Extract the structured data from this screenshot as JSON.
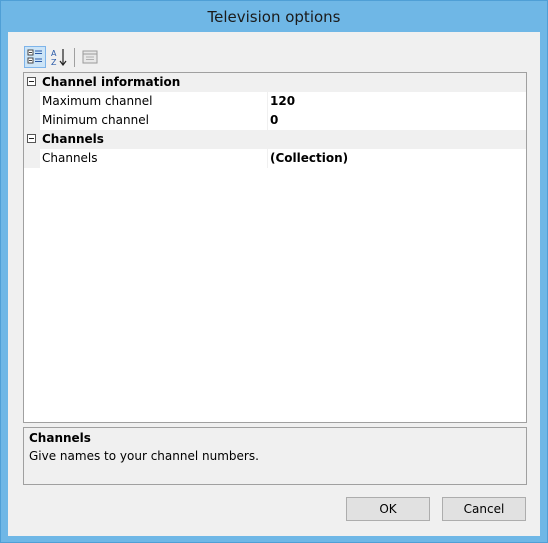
{
  "window": {
    "title": "Television options"
  },
  "toolbar": {
    "categorized_icon": "categorized-icon",
    "alphabetical_icon": "sort-az-icon",
    "property_pages_icon": "property-pages-icon"
  },
  "grid": {
    "categories": [
      {
        "label": "Channel information",
        "properties": [
          {
            "name": "Maximum channel",
            "value": "120"
          },
          {
            "name": "Minimum channel",
            "value": "0"
          }
        ]
      },
      {
        "label": "Channels",
        "properties": [
          {
            "name": "Channels",
            "value": "(Collection)"
          }
        ]
      }
    ]
  },
  "description": {
    "title": "Channels",
    "text": "Give names to your channel numbers."
  },
  "buttons": {
    "ok": "OK",
    "cancel": "Cancel"
  },
  "colors": {
    "frame": "#6fb7e6",
    "client": "#f0f0f0",
    "selected_tool": "#cce4f7"
  }
}
